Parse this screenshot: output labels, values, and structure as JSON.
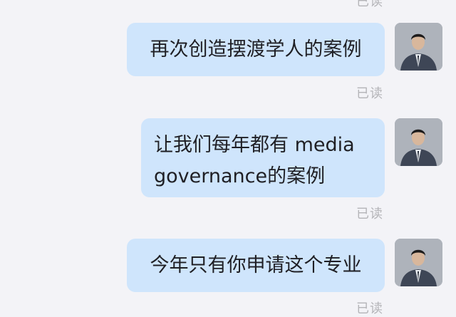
{
  "chat": {
    "read_label_top": "已读",
    "messages": [
      {
        "text": "再次创造摆渡学人的案例",
        "status": "已读"
      },
      {
        "text": "让我们每年都有 media governance的案例",
        "lines": [
          "让我们每年都有 media",
          "governance的案例"
        ],
        "status": "已读"
      },
      {
        "text": "今年只有你申请这个专业",
        "status": "已读"
      }
    ],
    "bubble_color": "#cfe5fc",
    "background_color": "#f3f3f7",
    "avatar_icon": "user-avatar-suit"
  }
}
